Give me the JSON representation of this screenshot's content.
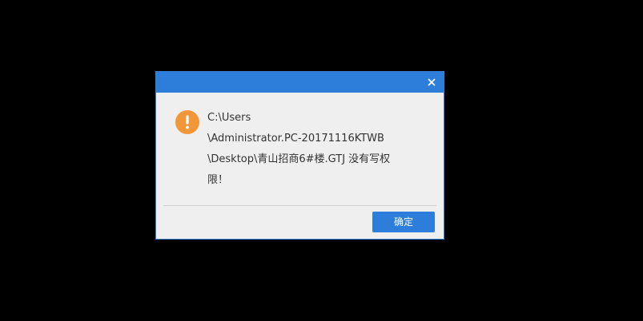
{
  "dialog": {
    "close_icon": "close-icon",
    "warning_icon": "exclamation-warning-icon",
    "message_lines": [
      "C:\\Users",
      "\\Administrator.PC-20171116KTWB",
      "\\Desktop\\青山招商6#楼.GTJ 没有写权",
      "限！"
    ],
    "ok_label": "确定"
  },
  "colors": {
    "titlebar": "#2d7ddb",
    "warning": "#f2963a",
    "button": "#2d7ddb",
    "dialog_bg": "#efefef",
    "backdrop": "#000000"
  }
}
